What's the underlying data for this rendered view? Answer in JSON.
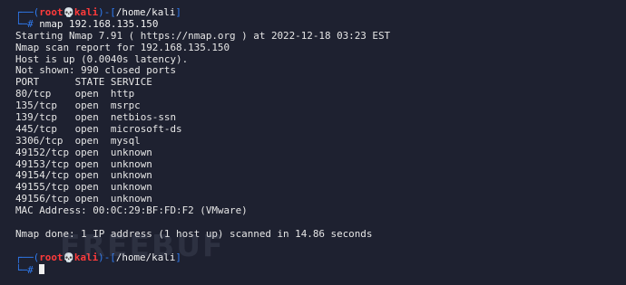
{
  "prompt": {
    "user": "root",
    "host": "kali",
    "path": "/home/kali",
    "skull_icon": "skull-icon"
  },
  "command": "nmap 192.168.135.150",
  "output": {
    "start": "Starting Nmap 7.91 ( https://nmap.org ) at 2022-12-18 03:23 EST",
    "report": "Nmap scan report for 192.168.135.150",
    "host_up": "Host is up (0.0040s latency).",
    "not_shown": "Not shown: 990 closed ports",
    "header": "PORT      STATE SERVICE",
    "ports": [
      "80/tcp    open  http",
      "135/tcp   open  msrpc",
      "139/tcp   open  netbios-ssn",
      "445/tcp   open  microsoft-ds",
      "3306/tcp  open  mysql",
      "49152/tcp open  unknown",
      "49153/tcp open  unknown",
      "49154/tcp open  unknown",
      "49155/tcp open  unknown",
      "49156/tcp open  unknown"
    ],
    "mac": "MAC Address: 00:0C:29:BF:FD:F2 (VMware)",
    "done": "Nmap done: 1 IP address (1 host up) scanned in 14.86 seconds"
  },
  "watermark": "FREEBUF",
  "colors": {
    "background": "#1e2130",
    "prompt_frame": "#2f7bf0",
    "user_host": "#ff3b3b",
    "text": "#e6e6e6"
  }
}
